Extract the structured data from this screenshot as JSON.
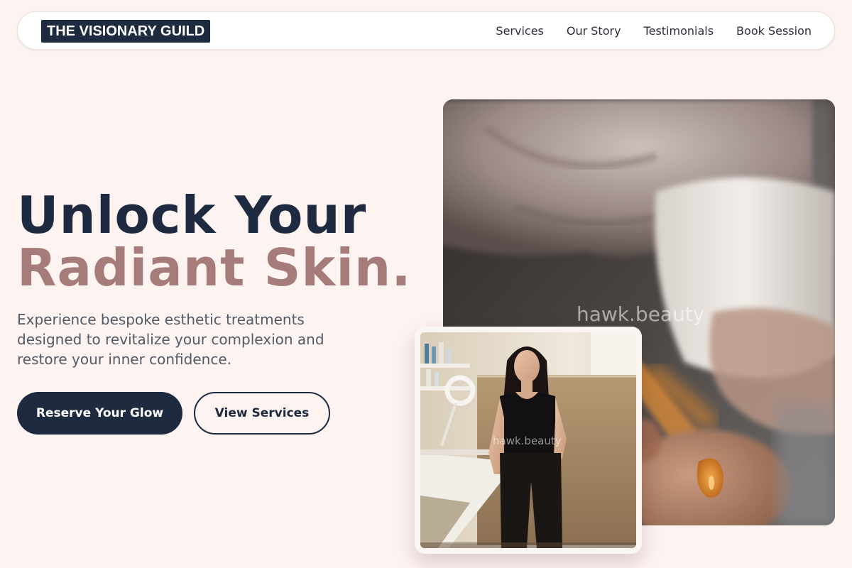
{
  "brand": {
    "name": "THE VISIONARY GUILD"
  },
  "nav": {
    "links": [
      {
        "label": "Services"
      },
      {
        "label": "Our Story"
      },
      {
        "label": "Testimonials"
      },
      {
        "label": "Book Session"
      }
    ]
  },
  "hero": {
    "headline_line1": "Unlock Your",
    "headline_line2": "Radiant Skin.",
    "description": "Experience bespoke esthetic treatments designed to revitalize your complexion and restore your inner confidence.",
    "primary_cta": "Reserve Your Glow",
    "secondary_cta": "View Services"
  },
  "images": {
    "hero_watermark": "hawk.beauty",
    "portrait_watermark": "hawk.beauty"
  },
  "colors": {
    "background": "#fdf3f1",
    "navy": "#1d2a40",
    "rose": "#a67c7a",
    "body_text": "#525a66"
  }
}
